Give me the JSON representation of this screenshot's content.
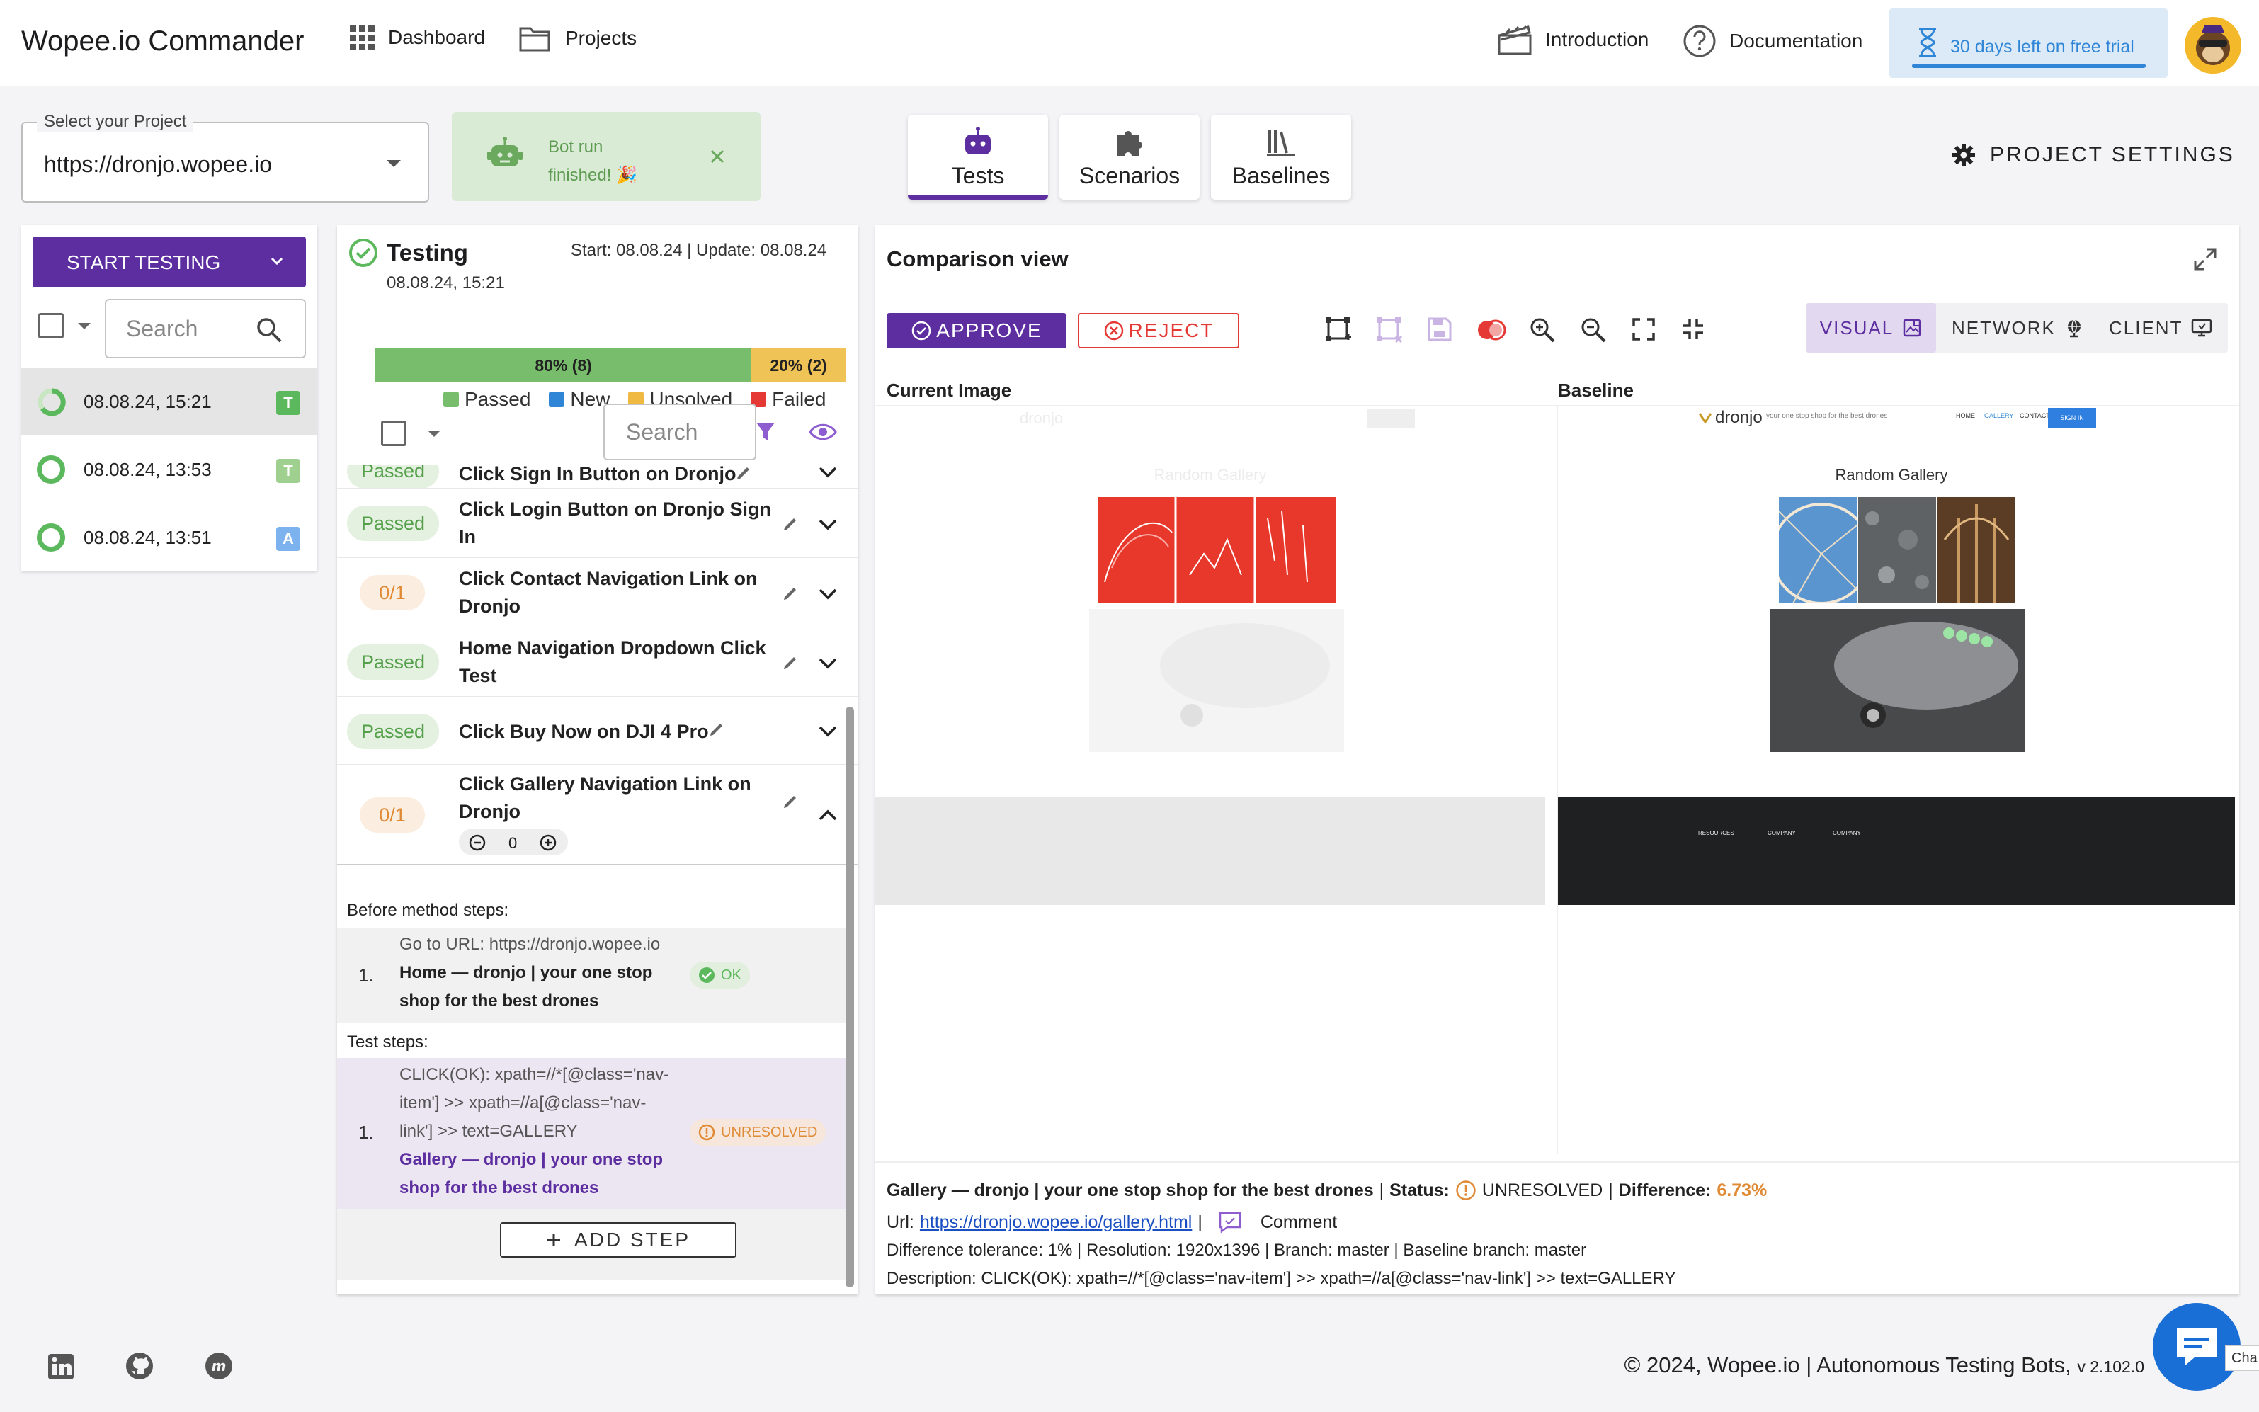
{
  "header": {
    "brand": "Wopee.io Commander",
    "nav": {
      "dashboard": "Dashboard",
      "projects": "Projects",
      "introduction": "Introduction",
      "documentation": "Documentation"
    },
    "trial": "30 days left on free trial"
  },
  "project": {
    "label": "Select your Project",
    "value": "https://dronjo.wopee.io"
  },
  "toast": {
    "text": "Bot run finished! 🎉"
  },
  "tabs": [
    {
      "label": "Tests",
      "icon": "robot-icon"
    },
    {
      "label": "Scenarios",
      "icon": "puzzle-icon"
    },
    {
      "label": "Baselines",
      "icon": "library-icon"
    }
  ],
  "project_settings": "PROJECT SETTINGS",
  "left": {
    "start_testing": "START TESTING",
    "search_placeholder": "Search",
    "runs": [
      {
        "date": "08.08.24, 15:21",
        "badge": "T"
      },
      {
        "date": "08.08.24, 13:53",
        "badge": "T"
      },
      {
        "date": "08.08.24, 13:51",
        "badge": "A"
      }
    ]
  },
  "testing": {
    "title": "Testing",
    "date": "08.08.24, 15:21",
    "start_update": "Start: 08.08.24 | Update: 08.08.24",
    "progress": [
      {
        "label": "80% (8)",
        "value": 0.8
      },
      {
        "label": "20% (2)",
        "value": 0.2
      }
    ],
    "legend": [
      "Passed",
      "New",
      "Unsolved",
      "Failed"
    ],
    "search_placeholder": "Search",
    "steps": [
      {
        "status": "Passed",
        "name": "Click Sign In Button on Dronjo"
      },
      {
        "status": "Passed",
        "name_1": "Click Login Button on Dronjo Sign",
        "name_2": "In"
      },
      {
        "status": "0/1",
        "name_1": "Click Contact Navigation Link on",
        "name_2": "Dronjo"
      },
      {
        "status": "Passed",
        "name_1": "Home Navigation Dropdown Click",
        "name_2": "Test"
      },
      {
        "status": "Passed",
        "name": "Click Buy Now on DJI 4 Pro"
      },
      {
        "status": "0/1",
        "name_1": "Click Gallery Navigation Link on",
        "name_2": "Dronjo",
        "counter": "0"
      }
    ],
    "before_label": "Before method steps:",
    "before_step": {
      "num": "1.",
      "line": "Go to URL: https://dronjo.wopee.io",
      "title_1": "Home — dronjo | your one stop",
      "title_2": "shop for the best drones",
      "status": "OK"
    },
    "test_label": "Test steps:",
    "test_step": {
      "num": "1.",
      "line_1": "CLICK(OK): xpath=//*[@class='nav-",
      "line_2": "item'] >> xpath=//a[@class='nav-",
      "line_3": "link'] >> text=GALLERY",
      "title_1": "Gallery — dronjo | your one stop",
      "title_2": "shop for the best drones",
      "status": "UNRESOLVED"
    },
    "add_step": "ADD STEP"
  },
  "comparison": {
    "title": "Comparison view",
    "approve": "APPROVE",
    "reject": "REJECT",
    "modes": [
      "VISUAL",
      "NETWORK",
      "CLIENT"
    ],
    "current_label": "Current Image",
    "baseline_label": "Baseline",
    "shot": {
      "logo": "dronjo",
      "tagline": "your one stop shop for the best drones",
      "menu": [
        "HOME",
        "GALLERY",
        "CONTACT"
      ],
      "signin": "SIGN IN",
      "gallery_title": "Random Gallery",
      "footer_cols": [
        "RESOURCES",
        "COMPANY",
        "COMPANY"
      ]
    },
    "info": {
      "page": "Gallery — dronjo | your one stop shop for the best drones",
      "status_label": "Status:",
      "status": "UNRESOLVED",
      "diff_label": "Difference:",
      "diff": "6.73%",
      "url_label": "Url:",
      "url": "https://dronjo.wopee.io/gallery.html",
      "comment": "Comment",
      "details": "Difference tolerance: 1% | Resolution: 1920x1396 | Branch: master | Baseline branch: master",
      "description": "Description: CLICK(OK): xpath=//*[@class='nav-item'] >> xpath=//a[@class='nav-link'] >> text=GALLERY"
    }
  },
  "footer": {
    "copyright": "© 2024, Wopee.io | Autonomous Testing Bots,",
    "version": "v 2.102.0",
    "chat": "Cha"
  },
  "colors": {
    "primary": "#5d2ea0",
    "passed": "#5cb85c",
    "new": "#2f86d6",
    "unresolved": "#f0b942",
    "failed": "#e53935"
  }
}
